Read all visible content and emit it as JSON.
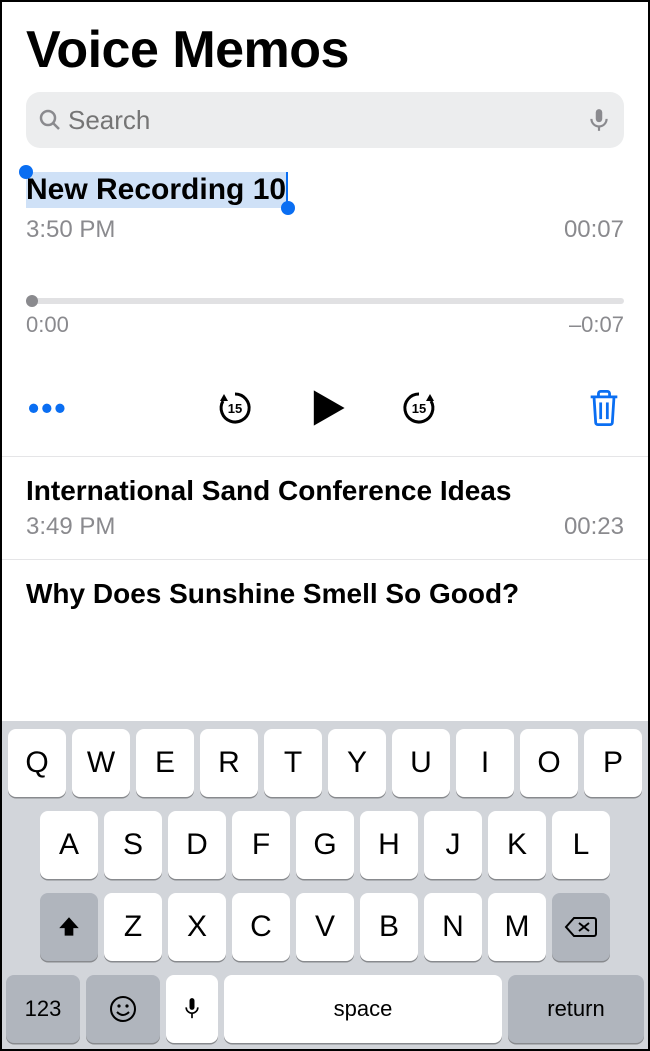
{
  "header": {
    "title": "Voice Memos"
  },
  "search": {
    "placeholder": "Search"
  },
  "expanded": {
    "title": "New Recording 10",
    "time": "3:50 PM",
    "duration": "00:07",
    "elapsed": "0:00",
    "remaining": "–0:07",
    "skip_amount": "15"
  },
  "items": [
    {
      "title": "International Sand Conference Ideas",
      "time": "3:49 PM",
      "duration": "00:23"
    },
    {
      "title": "Why Does Sunshine Smell So Good?"
    }
  ],
  "keyboard": {
    "row1": [
      "Q",
      "W",
      "E",
      "R",
      "T",
      "Y",
      "U",
      "I",
      "O",
      "P"
    ],
    "row2": [
      "A",
      "S",
      "D",
      "F",
      "G",
      "H",
      "J",
      "K",
      "L"
    ],
    "row3": [
      "Z",
      "X",
      "C",
      "V",
      "B",
      "N",
      "M"
    ],
    "numbers_label": "123",
    "space_label": "space",
    "return_label": "return"
  },
  "colors": {
    "accent": "#0a6ef2"
  }
}
